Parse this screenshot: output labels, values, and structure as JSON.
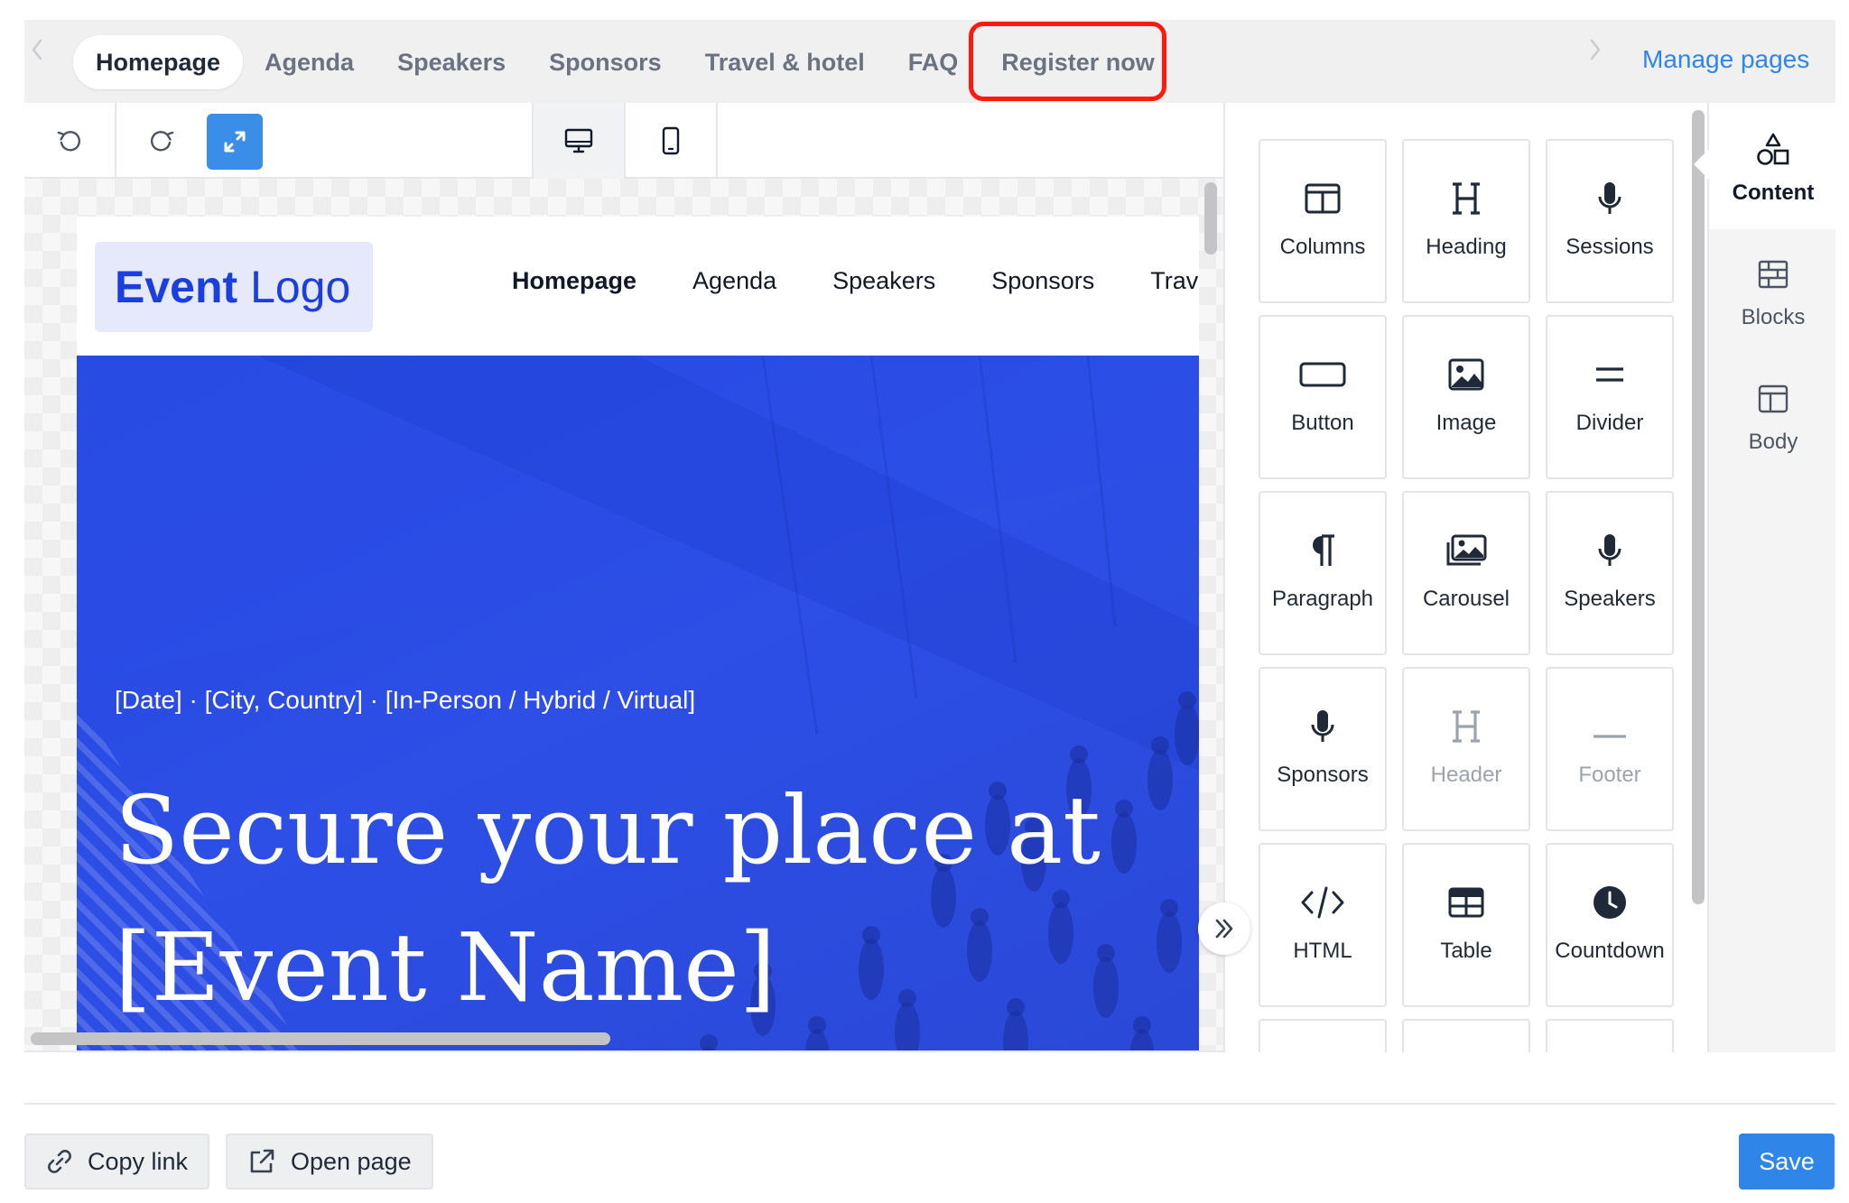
{
  "page_tabs": {
    "items": [
      "Homepage",
      "Agenda",
      "Speakers",
      "Sponsors",
      "Travel & hotel",
      "FAQ",
      "Register now"
    ],
    "active": "Homepage",
    "highlighted": "Register now",
    "manage_pages": "Manage pages"
  },
  "toolbar": {
    "undo": "undo-icon",
    "redo": "redo-icon",
    "fullscreen": "expand-icon",
    "views": [
      "desktop-icon",
      "mobile-icon"
    ],
    "active_view": "desktop"
  },
  "site": {
    "logo_bold": "Event",
    "logo_rest": " Logo",
    "nav": [
      "Homepage",
      "Agenda",
      "Speakers",
      "Sponsors",
      "Trave"
    ],
    "hero_meta": "[Date] · [City, Country] · [In-Person / Hybrid / Virtual]",
    "hero_title_line1": "Secure your place at",
    "hero_title_line2": "[Event Name]"
  },
  "palette": {
    "tiles": [
      {
        "label": "Columns",
        "icon": "columns-icon",
        "disabled": false
      },
      {
        "label": "Heading",
        "icon": "heading-icon",
        "disabled": false
      },
      {
        "label": "Sessions",
        "icon": "microphone-icon",
        "disabled": false
      },
      {
        "label": "Button",
        "icon": "button-icon",
        "disabled": false
      },
      {
        "label": "Image",
        "icon": "image-icon",
        "disabled": false
      },
      {
        "label": "Divider",
        "icon": "divider-icon",
        "disabled": false
      },
      {
        "label": "Paragraph",
        "icon": "paragraph-icon",
        "disabled": false
      },
      {
        "label": "Carousel",
        "icon": "carousel-icon",
        "disabled": false
      },
      {
        "label": "Speakers",
        "icon": "microphone-icon",
        "disabled": false
      },
      {
        "label": "Sponsors",
        "icon": "microphone-icon",
        "disabled": false
      },
      {
        "label": "Header",
        "icon": "heading-icon",
        "disabled": true
      },
      {
        "label": "Footer",
        "icon": "footer-icon",
        "disabled": true
      },
      {
        "label": "HTML",
        "icon": "code-icon",
        "disabled": false
      },
      {
        "label": "Table",
        "icon": "table-icon",
        "disabled": false
      },
      {
        "label": "Countdown",
        "icon": "clock-icon",
        "disabled": false
      }
    ]
  },
  "sidebar": {
    "items": [
      {
        "label": "Content",
        "icon": "shapes-icon",
        "active": true
      },
      {
        "label": "Blocks",
        "icon": "blocks-icon",
        "active": false
      },
      {
        "label": "Body",
        "icon": "layout-icon",
        "active": false
      }
    ]
  },
  "footer": {
    "copy_link": "Copy link",
    "open_page": "Open page",
    "save": "Save"
  },
  "colors": {
    "accent": "#2f86e8",
    "brand_blue": "#2447e0",
    "highlight_box": "#ff1a0e"
  }
}
